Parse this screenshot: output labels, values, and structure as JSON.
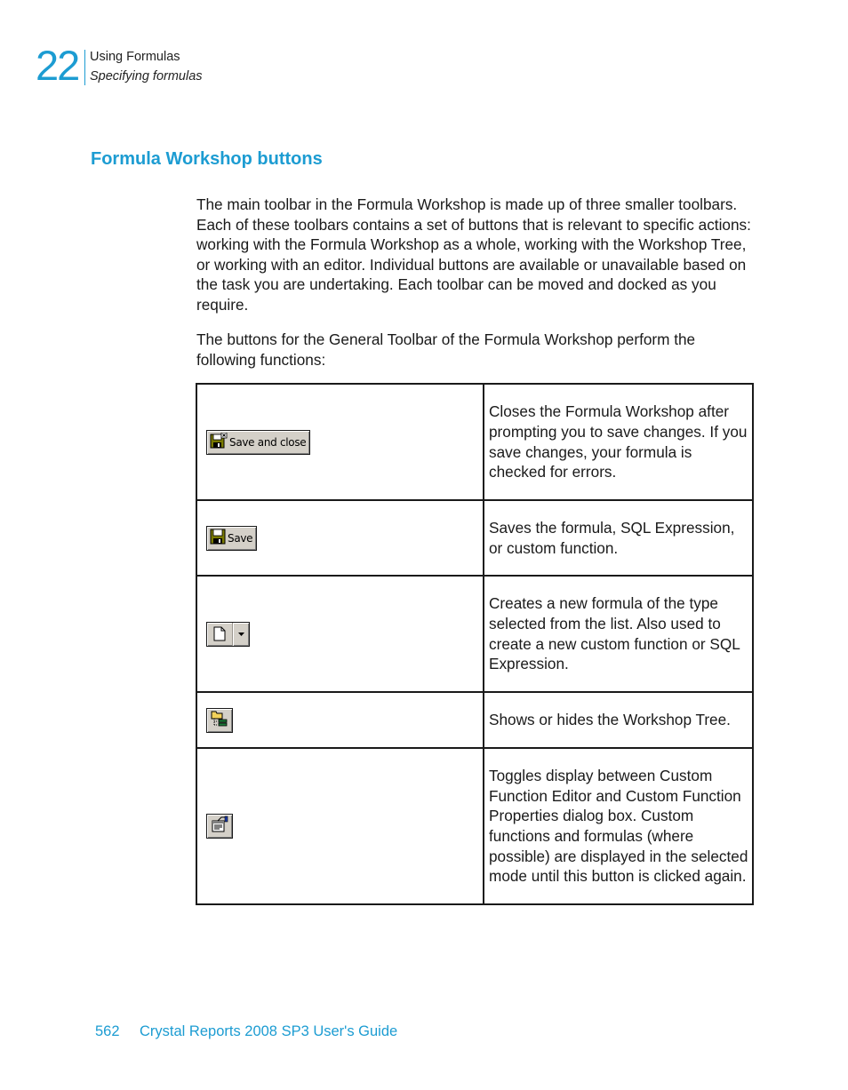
{
  "header": {
    "chapter_number": "22",
    "chapter_title": "Using Formulas",
    "section_subtitle": "Specifying formulas"
  },
  "section": {
    "title": "Formula Workshop buttons"
  },
  "paragraphs": [
    "The main toolbar in the Formula Workshop is made up of three smaller toolbars. Each of these toolbars contains a set of buttons that is relevant to specific actions: working with the Formula Workshop as a whole, working with the Workshop Tree, or working with an editor. Individual buttons are available or unavailable based on the task you are undertaking. Each toolbar can be moved and docked as you require.",
    "The buttons for the General Toolbar of the Formula Workshop perform the following functions:"
  ],
  "buttons_table": {
    "rows": [
      {
        "icon": "save-and-close-icon",
        "label": "Save and close",
        "description": "Closes the Formula Workshop after prompting you to save changes. If you save changes, your formula is checked for errors."
      },
      {
        "icon": "save-icon",
        "label": "Save",
        "description": "Saves the formula, SQL Expression, or custom function."
      },
      {
        "icon": "new-document-dropdown-icon",
        "label": "",
        "description": "Creates a new formula of the type selected from the list. Also used to create a new custom function or SQL Expression."
      },
      {
        "icon": "workshop-tree-toggle-icon",
        "label": "",
        "description": "Shows or hides the Workshop Tree."
      },
      {
        "icon": "properties-toggle-icon",
        "label": "",
        "description": "Toggles display between Custom Function Editor and Custom Function Properties dialog box. Custom functions and formulas (where possible) are displayed in the selected mode until this button is clicked again."
      }
    ]
  },
  "footer": {
    "page_number": "562",
    "book_title": "Crystal Reports 2008 SP3 User's Guide"
  },
  "colors": {
    "accent": "#1c9cd2",
    "text": "#1a1a1a",
    "button_face": "#d4d0c8"
  }
}
